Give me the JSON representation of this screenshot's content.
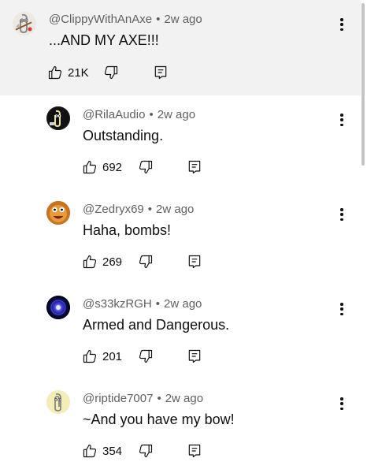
{
  "comments": [
    {
      "username": "@ClippyWithAnAxe",
      "time": "2w ago",
      "text": "...AND MY AXE!!!",
      "likes": "21K",
      "avatar": "clippy-axe-avatar",
      "highlighted": true
    },
    {
      "username": "@RilaAudio",
      "time": "2w ago",
      "text": "Outstanding.",
      "likes": "692",
      "avatar": "clippy-dark-avatar"
    },
    {
      "username": "@Zedryx69",
      "time": "2w ago",
      "text": "Haha, bombs!",
      "likes": "269",
      "avatar": "orange-face-avatar"
    },
    {
      "username": "@s33kzRGH",
      "time": "2w ago",
      "text": "Armed and Dangerous.",
      "likes": "201",
      "avatar": "blue-orb-avatar"
    },
    {
      "username": "@riptide7007",
      "time": "2w ago",
      "text": "~And you have my bow!",
      "likes": "354",
      "avatar": "clippy-yellow-avatar"
    }
  ],
  "separator": "•",
  "icons": {
    "like": "thumbs-up-icon",
    "dislike": "thumbs-down-icon",
    "reply": "reply-comment-icon",
    "menu": "more-vertical-icon"
  },
  "colors": {
    "highlight_bg": "#f2f2f2",
    "meta_text": "#606060",
    "primary_text": "#0f0f0f"
  }
}
